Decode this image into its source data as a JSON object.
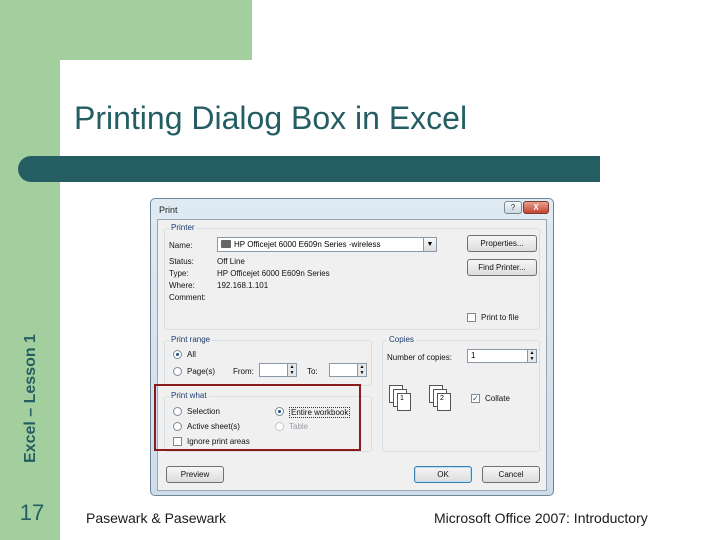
{
  "slide": {
    "title": "Printing Dialog Box in Excel",
    "vertical_label": "Excel – Lesson 1",
    "number": "17",
    "footer_left": "Pasewark & Pasewark",
    "footer_right": "Microsoft Office 2007:  Introductory"
  },
  "colors": {
    "accent": "#245e63",
    "frame_green": "#a3cf9e",
    "highlight": "#8b1a1a"
  },
  "dialog": {
    "title": "Print",
    "window_buttons": {
      "help": "?",
      "close": "X"
    },
    "printer": {
      "group_label": "Printer",
      "name_label": "Name:",
      "name_value": "HP Officejet 6000 E609n Series -wireless",
      "status_label": "Status:",
      "status_value": "Off Line",
      "type_label": "Type:",
      "type_value": "HP Officejet 6000 E609n Series",
      "where_label": "Where:",
      "where_value": "192.168.1.101",
      "comment_label": "Comment:",
      "properties_button": "Properties...",
      "find_printer_button": "Find Printer...",
      "print_to_file_label": "Print to file",
      "print_to_file_checked": false
    },
    "print_range": {
      "group_label": "Print range",
      "all_label": "All",
      "pages_label": "Page(s)",
      "from_label": "From:",
      "to_label": "To:",
      "selected": "All"
    },
    "print_what": {
      "group_label": "Print what",
      "selection_label": "Selection",
      "active_sheets_label": "Active sheet(s)",
      "entire_workbook_label": "Entire workbook",
      "table_label": "Table",
      "ignore_print_areas_label": "Ignore print areas",
      "selected": "Entire workbook",
      "ignore_print_areas_checked": false
    },
    "copies": {
      "group_label": "Copies",
      "number_label": "Number of copies:",
      "number_value": "1",
      "collate_label": "Collate",
      "collate_checked": true,
      "page_icon_labels": [
        "1",
        "2",
        "3"
      ]
    },
    "buttons": {
      "preview": "Preview",
      "ok": "OK",
      "cancel": "Cancel"
    }
  }
}
